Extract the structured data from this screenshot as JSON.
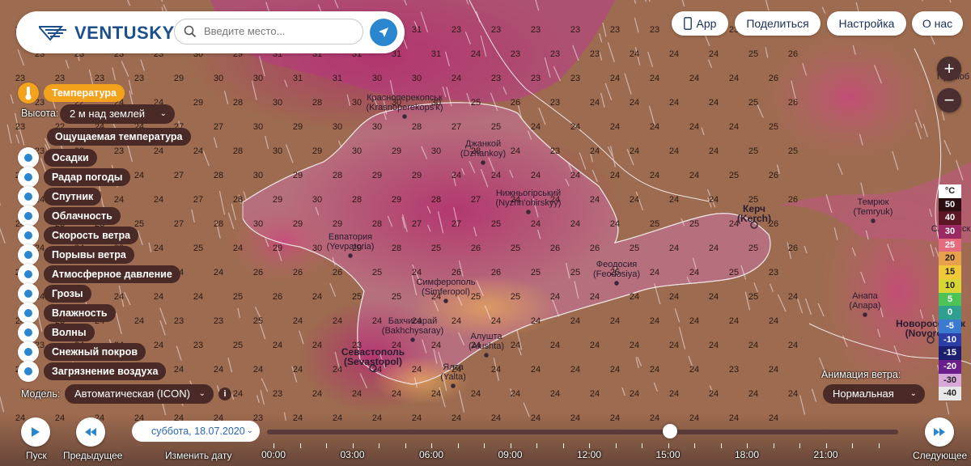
{
  "brand": {
    "name": "VENTUSKY"
  },
  "search": {
    "placeholder": "Введите место..."
  },
  "topnav": {
    "app": "App",
    "share": "Поделиться",
    "settings": "Настройка",
    "about": "О нас"
  },
  "layers": {
    "active": "Температура",
    "height_label": "Высота:",
    "height_value": "2 м над землей",
    "feels_like": "Ощущаемая температура",
    "items": [
      "Осадки",
      "Радар погоды",
      "Спутник",
      "Облачность",
      "Скорость ветра",
      "Порывы ветра",
      "Атмосферное давление",
      "Грозы",
      "Влажность",
      "Волны",
      "Снежный покров",
      "Загрязнение воздуха"
    ]
  },
  "model": {
    "label": "Модель:",
    "value": "Автоматическая (ICON)"
  },
  "animation": {
    "label": "Анимация ветра:",
    "value": "Нормальная"
  },
  "legend": {
    "unit": "°C",
    "values": [
      "50",
      "40",
      "30",
      "25",
      "20",
      "15",
      "10",
      "5",
      "0",
      "-5",
      "-10",
      "-15",
      "-20",
      "-30",
      "-40"
    ],
    "colors": [
      "#2a0e10",
      "#5c1624",
      "#9b2a63",
      "#e56c7e",
      "#e8a04a",
      "#f0c83a",
      "#d7d636",
      "#4cc257",
      "#2fa08e",
      "#3a7ad1",
      "#2b3ea8",
      "#1c1f70",
      "#6b1e8c",
      "#d8a8d8",
      "#e8e8e8"
    ]
  },
  "timeline": {
    "date": "суббота, 18.07.2020",
    "ticks": [
      "00:00",
      "03:00",
      "06:00",
      "09:00",
      "12:00",
      "15:00",
      "18:00",
      "21:00"
    ],
    "play": "Пуск",
    "prev": "Предыдущее",
    "change_date": "Изменить дату",
    "next": "Следующее"
  },
  "cities": [
    {
      "name": "Красноперекопськ",
      "sub": "(Krasnoperekops'k)"
    },
    {
      "name": "Джанкой",
      "sub": "(Dzhankoy)"
    },
    {
      "name": "Нижньогірський",
      "sub": "(Nyzhn'ohirskyy)"
    },
    {
      "name": "Евпатория",
      "sub": "(Yevpatoria)"
    },
    {
      "name": "Симферополь",
      "sub": "(Simferopol)"
    },
    {
      "name": "Бахчисарай",
      "sub": "(Bakhchysaray)"
    },
    {
      "name": "Алушта",
      "sub": "(Alushta)"
    },
    {
      "name": "Севастополь",
      "sub": "(Sevastopol)"
    },
    {
      "name": "Ялта",
      "sub": "(Yalta)"
    },
    {
      "name": "Феодосия",
      "sub": "(Feodosiya)"
    },
    {
      "name": "Керч",
      "sub": "(Kerch)"
    },
    {
      "name": "Темрюк",
      "sub": "(Temryuk)"
    },
    {
      "name": "Анапа",
      "sub": "(Anapa)"
    },
    {
      "name": "Новороссийск",
      "sub": "(Novorossi"
    },
    {
      "name": "Примоб",
      "sub": ""
    },
    {
      "name": "Славянск",
      "sub": "(Sla"
    }
  ],
  "temp_grid": [
    [
      "23",
      "23",
      "23",
      "23",
      "31",
      "31",
      "31",
      "31",
      "31",
      "31",
      "31",
      "23",
      "23",
      "23",
      "23",
      "23",
      "23",
      "23",
      "23",
      "23"
    ],
    [
      "23",
      "23",
      "23",
      "23",
      "30",
      "29",
      "31",
      "31",
      "31",
      "31",
      "31",
      "24",
      "23",
      "23",
      "23",
      "24",
      "24",
      "24",
      "25",
      "26"
    ],
    [
      "23",
      "23",
      "23",
      "23",
      "29",
      "30",
      "30",
      "31",
      "31",
      "30",
      "30",
      "24",
      "23",
      "23",
      "23",
      "24",
      "24",
      "24",
      "24",
      "26"
    ],
    [
      "23",
      "22",
      "24",
      "24",
      "29",
      "28",
      "30",
      "28",
      "30",
      "30",
      "30",
      "25",
      "26",
      "23",
      "24",
      "24",
      "24",
      "24",
      "25",
      "26"
    ],
    [
      "23",
      "22",
      "24",
      "24",
      "27",
      "27",
      "30",
      "29",
      "30",
      "30",
      "28",
      "27",
      "25",
      "24",
      "24",
      "24",
      "24",
      "24",
      "24",
      "25"
    ],
    [
      "23",
      "23",
      "23",
      "24",
      "24",
      "28",
      "30",
      "29",
      "30",
      "29",
      "30",
      "28",
      "24",
      "23",
      "24",
      "24",
      "24",
      "24",
      "25",
      "25"
    ],
    [
      "23",
      "23",
      "23",
      "24",
      "27",
      "28",
      "30",
      "29",
      "28",
      "29",
      "29",
      "24",
      "24",
      "24",
      "24",
      "24",
      "24",
      "24",
      "25",
      "26"
    ],
    [
      "24",
      "22",
      "24",
      "24",
      "27",
      "28",
      "29",
      "30",
      "28",
      "29",
      "28",
      "27",
      "24",
      "24",
      "24",
      "24",
      "24",
      "24",
      "25",
      "26"
    ],
    [
      "24",
      "23",
      "23",
      "25",
      "27",
      "28",
      "30",
      "29",
      "29",
      "28",
      "27",
      "27",
      "25",
      "24",
      "24",
      "24",
      "25",
      "25",
      "24",
      "26"
    ],
    [
      "24",
      "24",
      "23",
      "24",
      "25",
      "24",
      "29",
      "30",
      "29",
      "28",
      "25",
      "26",
      "25",
      "26",
      "26",
      "25",
      "24",
      "24",
      "25",
      "26"
    ],
    [
      "24",
      "24",
      "24",
      "23",
      "24",
      "24",
      "26",
      "26",
      "26",
      "25",
      "24",
      "26",
      "26",
      "25",
      "25",
      "25",
      "24",
      "24",
      "25",
      "23"
    ],
    [
      "24",
      "24",
      "24",
      "24",
      "24",
      "25",
      "26",
      "24",
      "25",
      "25",
      "24",
      "25",
      "25",
      "24",
      "24",
      "24",
      "24",
      "24",
      "25",
      "24"
    ],
    [
      "24",
      "23",
      "24",
      "24",
      "23",
      "23",
      "25",
      "24",
      "24",
      "24",
      "24",
      "24",
      "24",
      "24",
      "24",
      "24",
      "24",
      "24",
      "24",
      "24"
    ],
    [
      "23",
      "24",
      "24",
      "24",
      "23",
      "25",
      "24",
      "24",
      "23",
      "24",
      "24",
      "24",
      "24",
      "24",
      "24",
      "24",
      "24",
      "24",
      "24",
      "24"
    ],
    [
      "24",
      "24",
      "24",
      "24",
      "24",
      "24",
      "24",
      "24",
      "24",
      "24",
      "24",
      "24",
      "24",
      "24",
      "24",
      "24",
      "24",
      "24",
      "23",
      "24"
    ],
    [
      "24",
      "24",
      "24",
      "24",
      "24",
      "24",
      "23",
      "24",
      "24",
      "24",
      "24",
      "24",
      "24",
      "24",
      "24",
      "24",
      "24",
      "24",
      "24",
      "24"
    ],
    [
      "24",
      "24",
      "24",
      "24",
      "24",
      "24",
      "23",
      "24",
      "24",
      "24",
      "24",
      "24",
      "24",
      "24",
      "24",
      "24",
      "24",
      "24",
      "24",
      "24"
    ]
  ]
}
